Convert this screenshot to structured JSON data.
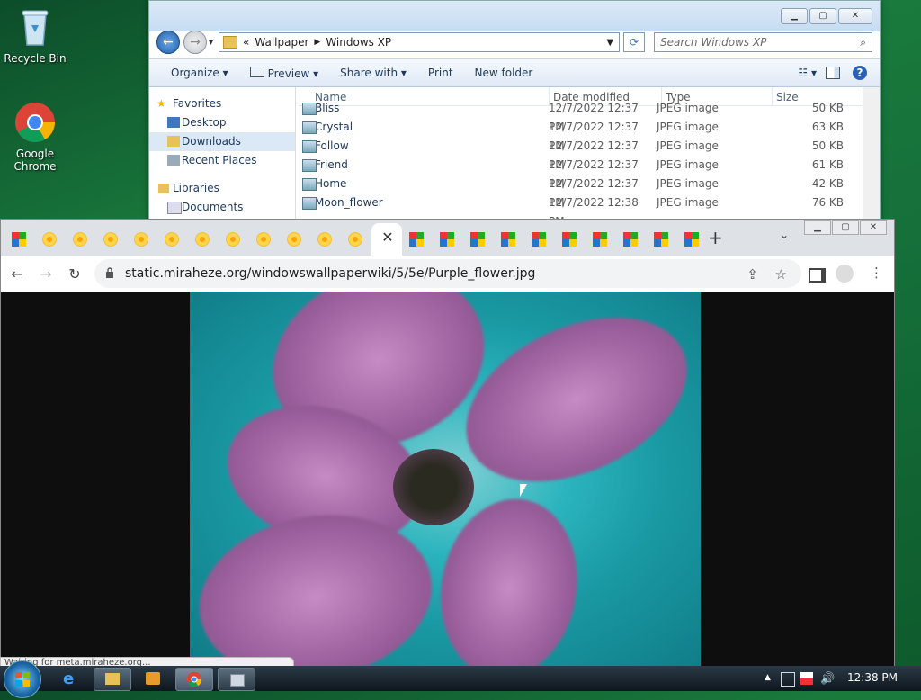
{
  "desktop": {
    "icons": [
      {
        "label": "Recycle Bin"
      },
      {
        "label": "Google Chrome"
      }
    ]
  },
  "explorer": {
    "breadcrumb": [
      "Wallpaper",
      "Windows XP"
    ],
    "search_placeholder": "Search Windows XP",
    "commands": [
      "Organize",
      "Preview",
      "Share with",
      "Print",
      "New folder"
    ],
    "nav": {
      "favorites": "Favorites",
      "items": [
        "Desktop",
        "Downloads",
        "Recent Places"
      ],
      "libraries": "Libraries",
      "library_items": [
        "Documents"
      ]
    },
    "columns": {
      "name": "Name",
      "date": "Date modified",
      "type": "Type",
      "size": "Size"
    },
    "files": [
      {
        "name": "Bliss",
        "date": "12/7/2022 12:37 PM",
        "type": "JPEG image",
        "size": "50 KB"
      },
      {
        "name": "Crystal",
        "date": "12/7/2022 12:37 PM",
        "type": "JPEG image",
        "size": "63 KB"
      },
      {
        "name": "Follow",
        "date": "12/7/2022 12:37 PM",
        "type": "JPEG image",
        "size": "50 KB"
      },
      {
        "name": "Friend",
        "date": "12/7/2022 12:37 PM",
        "type": "JPEG image",
        "size": "61 KB"
      },
      {
        "name": "Home",
        "date": "12/7/2022 12:37 PM",
        "type": "JPEG image",
        "size": "42 KB"
      },
      {
        "name": "Moon_flower",
        "date": "12/7/2022 12:38 PM",
        "type": "JPEG image",
        "size": "76 KB"
      }
    ]
  },
  "chrome": {
    "url": "static.miraheze.org/windowswallpaperwiki/5/5e/Purple_flower.jpg",
    "tabs_left_flower_count": 12,
    "tabs_right_xp_count": 10,
    "status_text": "Waiting for meta.miraheze.org..."
  },
  "taskbar": {
    "clock": "12:38 PM"
  }
}
